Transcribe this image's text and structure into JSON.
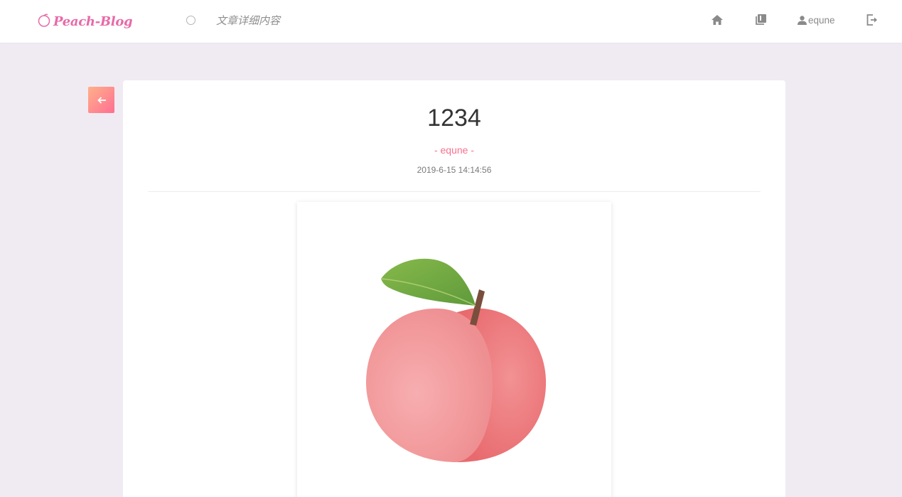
{
  "app": {
    "logo_text": "Peach-Blog",
    "page_name": "文章详细内容"
  },
  "nav": {
    "icons": [
      "home-icon",
      "library-icon",
      "user-icon",
      "logout-icon"
    ],
    "username": "equne"
  },
  "article": {
    "title": "1234",
    "author_line": "- equne -",
    "date": "2019-6-15 14:14:56",
    "image": "peach-illustration"
  },
  "colors": {
    "brand": "#e86aa7",
    "accent": "#f7718f",
    "background": "#f0ebf2"
  }
}
